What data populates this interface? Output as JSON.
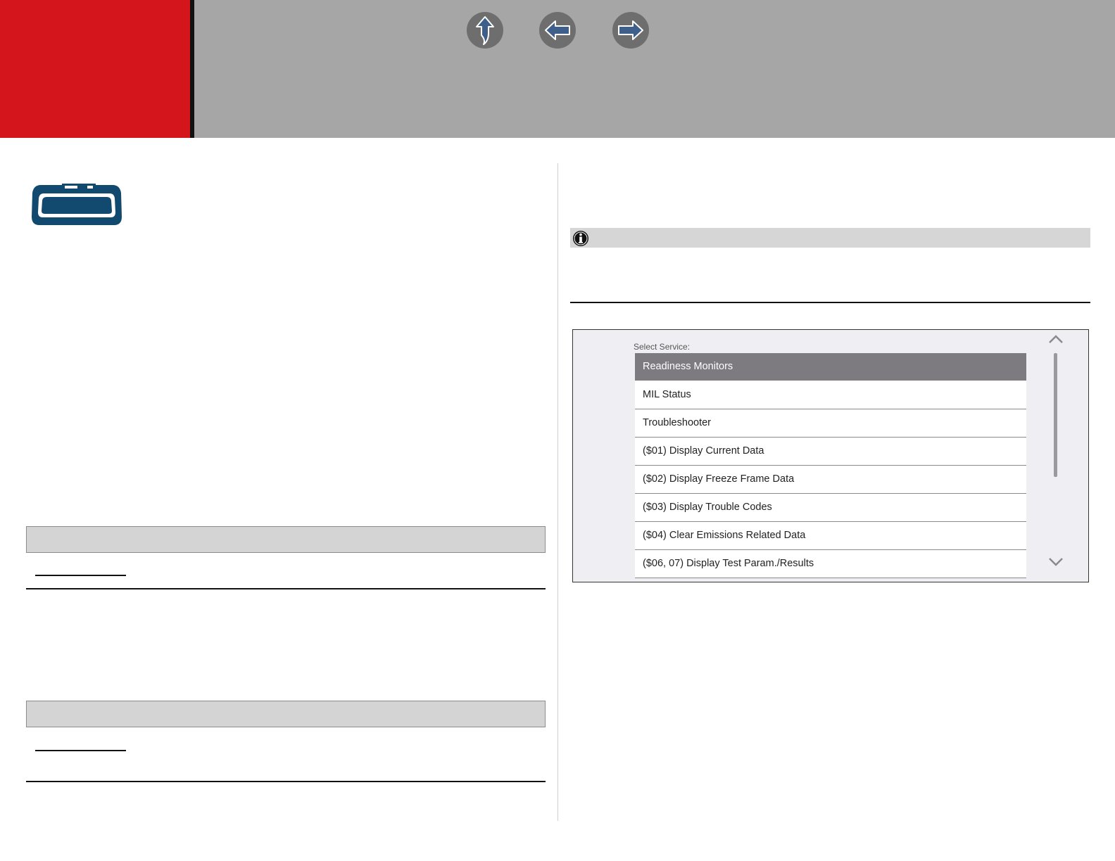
{
  "header": {
    "colors": {
      "brand_red": "#d4151b",
      "bar_gray": "#a6a6a6",
      "nav_button": "#6e6e6e",
      "arrow_fill": "#3d5f8a"
    },
    "nav": [
      {
        "id": "up",
        "icon": "up-arrow-icon"
      },
      {
        "id": "back",
        "icon": "left-arrow-icon"
      },
      {
        "id": "forward",
        "icon": "right-arrow-icon"
      }
    ]
  },
  "left": {
    "section_icon": "windshield-icon",
    "icon_color": "#12496f"
  },
  "right": {
    "note_icon": "info-icon"
  },
  "screen": {
    "label": "Select Service:",
    "items": [
      {
        "label": "Readiness Monitors",
        "selected": true
      },
      {
        "label": "MIL Status",
        "selected": false
      },
      {
        "label": "Troubleshooter",
        "selected": false
      },
      {
        "label": "($01) Display Current Data",
        "selected": false
      },
      {
        "label": "($02) Display Freeze Frame Data",
        "selected": false
      },
      {
        "label": "($03) Display Trouble Codes",
        "selected": false
      },
      {
        "label": "($04) Clear Emissions Related Data",
        "selected": false
      },
      {
        "label": "($06, 07) Display Test Param./Results",
        "selected": false
      }
    ],
    "scroll_icons": [
      "chevron-up-icon",
      "chevron-down-icon"
    ]
  }
}
